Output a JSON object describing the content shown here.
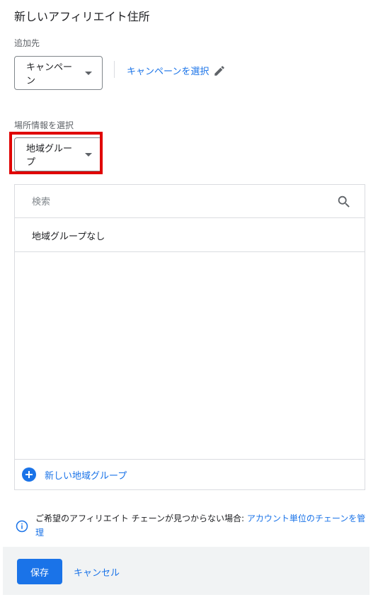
{
  "header": {
    "title": "新しいアフィリエイト住所"
  },
  "destination": {
    "label": "追加先",
    "dropdown_value": "キャンペーン",
    "campaign_link": "キャンペーンを選択"
  },
  "location": {
    "label": "場所情報を選択",
    "dropdown_value": "地域グループ"
  },
  "list": {
    "search_placeholder": "検索",
    "options": [
      "地域グループなし"
    ],
    "new_group_label": "新しい地域グループ"
  },
  "info": {
    "text": "ご希望のアフィリエイト チェーンが見つからない場合: ",
    "link": "アカウント単位のチェーンを管理"
  },
  "footer": {
    "save_label": "保存",
    "cancel_label": "キャンセル"
  },
  "colors": {
    "accent": "#1a73e8",
    "highlight": "#e00000",
    "footer_bg": "#f1f3f4"
  },
  "icons": [
    "caret-down-icon",
    "pencil-icon",
    "search-icon",
    "plus-circle-icon",
    "info-icon"
  ]
}
